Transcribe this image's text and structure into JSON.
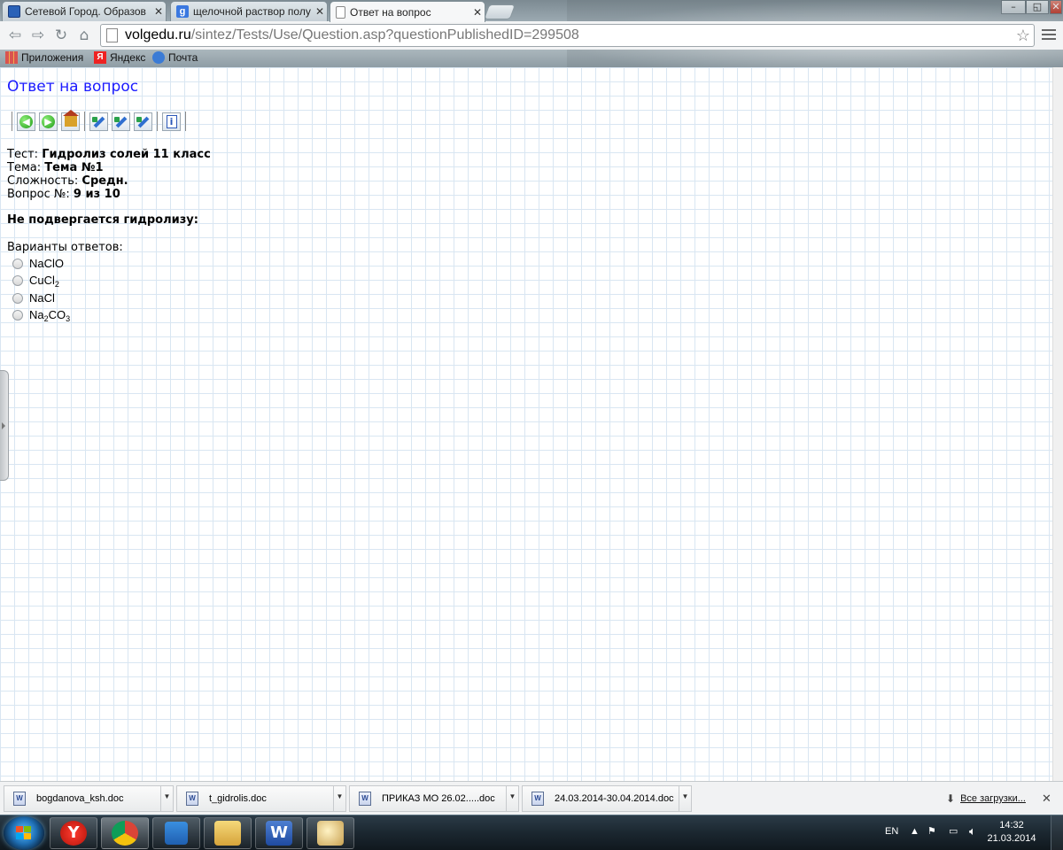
{
  "browser": {
    "tabs": [
      {
        "title": "Сетевой Город. Образов",
        "active": false
      },
      {
        "title": "щелочной раствор полу",
        "active": false
      },
      {
        "title": "Ответ на вопрос",
        "active": true
      }
    ],
    "url_domain": "volgedu.ru",
    "url_path": "/sintez/Tests/Use/Question.asp?questionPublishedID=299508",
    "bookmarks": [
      "Приложения",
      "Яндекс",
      "Почта"
    ],
    "window_controls": {
      "minimize": "–",
      "restore": "◱",
      "close": "✕"
    }
  },
  "page": {
    "title": "Ответ на вопрос",
    "meta": {
      "test_label": "Тест:",
      "test_value": "Гидролиз солей 11 класс",
      "topic_label": "Тема:",
      "topic_value": "Тема №1",
      "difficulty_label": "Сложность:",
      "difficulty_value": "Средн.",
      "question_label": "Вопрос №:",
      "question_value": "9 из 10"
    },
    "question_text": "Не подвергается гидролизу:",
    "answers_label": "Варианты ответов:",
    "answers": [
      {
        "parts": [
          "NaClO"
        ]
      },
      {
        "parts": [
          "CuCl",
          "2"
        ]
      },
      {
        "parts": [
          "NaCl"
        ]
      },
      {
        "parts": [
          "Na",
          "2",
          "CO",
          "3"
        ]
      }
    ]
  },
  "downloads": {
    "files": [
      "bogdanova_ksh.doc",
      "t_gidrolis.doc",
      "ПРИКАЗ МО 26.02.....doc",
      "24.03.2014-30.04.2014.doc"
    ],
    "all_label": "Все загрузки..."
  },
  "taskbar": {
    "language": "EN",
    "time": "14:32",
    "date": "21.03.2014"
  },
  "colors": {
    "page_title": "#1a1aff",
    "grid_line": "#d9e6f2"
  }
}
